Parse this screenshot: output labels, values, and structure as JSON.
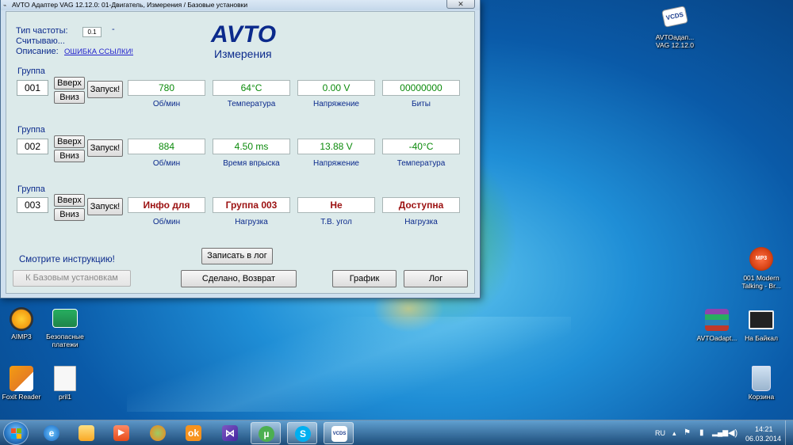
{
  "window": {
    "title": "AVTO Адаптер VAG 12.12.0: 01-Двигатель,  Измерения / Базовые установки",
    "close_glyph": "✕"
  },
  "header": {
    "freq_type_label": "Тип частоты:",
    "freq_type_value": "0.1",
    "freq_dash": "-",
    "reading_label": "Считываю...",
    "description_label": "Описание:",
    "description_link": "ОШИБКА ССЫЛКИ!",
    "brand": "AVTO",
    "subtitle": "Измерения"
  },
  "groups": [
    {
      "label": "Группа",
      "number": "001",
      "up": "Вверх",
      "down": "Вниз",
      "go": "Запуск!",
      "values": [
        "780",
        "64°C",
        "0.00 V",
        "00000000"
      ],
      "captions": [
        "Об/мин",
        "Температура",
        "Напряжение",
        "Биты"
      ]
    },
    {
      "label": "Группа",
      "number": "002",
      "up": "Вверх",
      "down": "Вниз",
      "go": "Запуск!",
      "values": [
        "884",
        "4.50 ms",
        "13.88 V",
        "-40°C"
      ],
      "captions": [
        "Об/мин",
        "Время впрыска",
        "Напряжение",
        "Температура"
      ]
    },
    {
      "label": "Группа",
      "number": "003",
      "up": "Вверх",
      "down": "Вниз",
      "go": "Запуск!",
      "values": [
        "Инфо для",
        "Группа 003",
        "Не",
        "Доступна"
      ],
      "captions": [
        "Об/мин",
        "Нагрузка",
        "Т.В. угол",
        "Нагрузка"
      ]
    }
  ],
  "footer": {
    "instructions": "Смотрите инструкцию!",
    "basic_settings": "К Базовым установкам",
    "write_log": "Записать в лог",
    "done_back": "Сделано, Возврат",
    "graph": "График",
    "log": "Лог"
  },
  "desktop": {
    "icons": [
      {
        "name": "vcds",
        "label": "AVTOадап... VAG 12.12.0",
        "icon": "vcds-icon"
      },
      {
        "name": "aimp3",
        "label": "AIMP3",
        "icon": "aimp-icon"
      },
      {
        "name": "payments",
        "label": "Безопасные платежи",
        "icon": "payment-card-icon"
      },
      {
        "name": "foxit",
        "label": "Foxit Reader",
        "icon": "foxit-icon"
      },
      {
        "name": "pril1",
        "label": "pril1",
        "icon": "document-icon"
      },
      {
        "name": "mp3",
        "label": "001 Modern Talking - Br...",
        "icon": "mp3-icon"
      },
      {
        "name": "avtoadapt",
        "label": "AVTOadapt...",
        "icon": "winrar-icon"
      },
      {
        "name": "baikal",
        "label": "На Байкал",
        "icon": "video-icon"
      },
      {
        "name": "recycle",
        "label": "Корзина",
        "icon": "recycle-bin-icon"
      }
    ]
  },
  "taskbar": {
    "apps": [
      "internet-explorer-icon",
      "explorer-folder-icon",
      "media-player-icon",
      "ccleaner-icon",
      "odnoklassniki-icon",
      "visual-studio-icon",
      "utorrent-icon",
      "skype-icon",
      "vcds-taskbar-icon"
    ],
    "language": "RU",
    "time": "14:21",
    "date": "06.03.2014"
  },
  "colors": {
    "label_blue": "#0b2a8c",
    "value_green": "#0b8a0b",
    "value_red": "#9b1010",
    "window_bg": "#dceaea"
  }
}
